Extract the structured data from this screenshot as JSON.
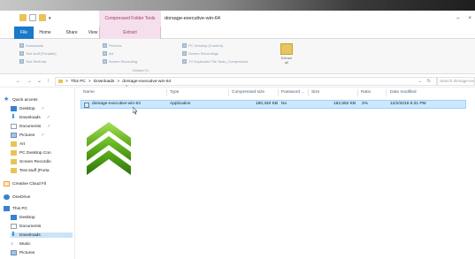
{
  "window": {
    "title": "dorsage-executive-win-64",
    "context_tab_group": "Compressed Folder Tools",
    "controls": [
      "–",
      "×"
    ]
  },
  "tabs": {
    "file": "File",
    "home": "Home",
    "share": "Share",
    "view": "View",
    "extract": "Extract"
  },
  "ribbon": {
    "items_col1": [
      "Downloads",
      "Test stuff (Portable)",
      "Test Stuff.bat"
    ],
    "items_col2": [
      "Pictures",
      "Art",
      "Screen Recording"
    ],
    "items_col3": [
      "PC Desktop (Content)",
      "Screen Recordings",
      "TV Duplicator File Tests_Compressed"
    ],
    "extract_all_label": "Extract all",
    "group_label": "Extract To"
  },
  "address": {
    "path": [
      "This PC",
      "Downloads",
      "dorsage-executive-win-64"
    ],
    "separator": ">",
    "search_placeholder": "Search dorsage-executive-win-64"
  },
  "nav_pane": {
    "quick_access": "Quick access",
    "items": [
      {
        "label": "Desktop",
        "icon": "desktop-icon",
        "pinned": true
      },
      {
        "label": "Downloads",
        "icon": "download-icon",
        "pinned": true
      },
      {
        "label": "Documents",
        "icon": "document-icon",
        "pinned": true
      },
      {
        "label": "Pictures",
        "icon": "picture-icon",
        "pinned": true
      },
      {
        "label": "Art",
        "icon": "folder-icon"
      },
      {
        "label": "PC Desktop Con",
        "icon": "folder-icon"
      },
      {
        "label": "Screen Recordin",
        "icon": "folder-icon"
      },
      {
        "label": "Test stuff (Porta",
        "icon": "folder-icon"
      }
    ],
    "creative_cloud": "Creative Cloud Fil",
    "onedrive": "OneDrive",
    "this_pc": "This PC",
    "pc_items": [
      {
        "label": "Desktop",
        "icon": "desktop-icon"
      },
      {
        "label": "Documents",
        "icon": "document-icon"
      },
      {
        "label": "Downloads",
        "icon": "download-icon",
        "selected": true
      },
      {
        "label": "Music",
        "icon": "music-icon"
      },
      {
        "label": "Pictures",
        "icon": "picture-icon"
      }
    ]
  },
  "columns": [
    "Name",
    "Type",
    "Compressed size",
    "Password ...",
    "Size",
    "Ratio",
    "Date modified"
  ],
  "files": [
    {
      "name": "dorsage-executive-win-64",
      "type": "Application",
      "compressed_size": "180,340 KB",
      "password": "No",
      "size": "182,652 KB",
      "ratio": "2%",
      "date": "12/2/2019 5:31 PM"
    }
  ],
  "colors": {
    "accent": "#1979ca",
    "context_tab": "#f6dfec",
    "selection": "#cce8ff",
    "arrow_green": "#6ebf1e"
  }
}
